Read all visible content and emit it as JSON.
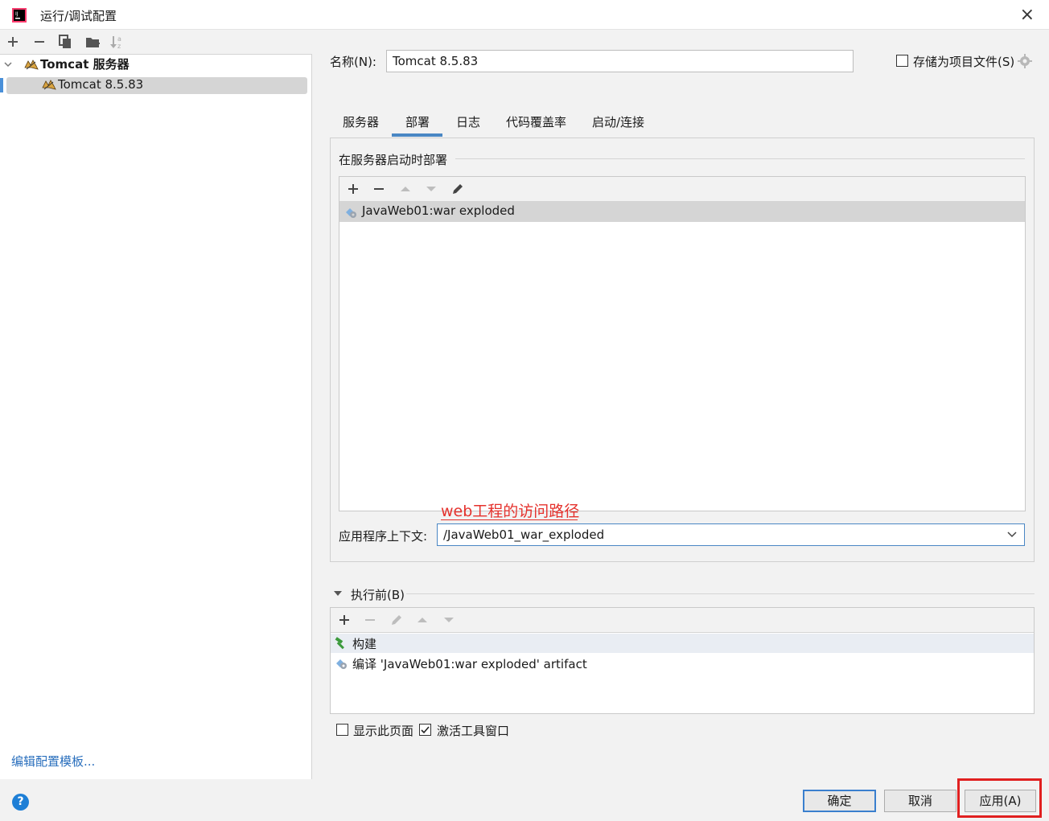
{
  "window": {
    "title": "运行/调试配置",
    "close_glyph": "×"
  },
  "left_toolbar": {
    "add_icon": "plus-icon",
    "remove_icon": "minus-icon",
    "copy_icon": "copy-icon",
    "folder_icon": "new-folder-icon",
    "sort_icon": "sort-icon"
  },
  "tree": {
    "group_label": "Tomcat 服务器",
    "group_icon": "tomcat-icon",
    "item_label": "Tomcat 8.5.83",
    "item_icon": "tomcat-icon"
  },
  "edit_templates_link": "编辑配置模板...",
  "help_glyph": "?",
  "form": {
    "name_label": "名称(N):",
    "name_value": "Tomcat 8.5.83",
    "store_as_project_label": "存储为项目文件(S)",
    "store_as_project_checked": false
  },
  "tabs": [
    {
      "label": "服务器",
      "active": false
    },
    {
      "label": "部署",
      "active": true
    },
    {
      "label": "日志",
      "active": false
    },
    {
      "label": "代码覆盖率",
      "active": false
    },
    {
      "label": "启动/连接",
      "active": false
    }
  ],
  "deploy": {
    "group_title": "在服务器启动时部署",
    "items": [
      {
        "label": "JavaWeb01:war exploded",
        "icon": "artifact-icon",
        "selected": true
      }
    ],
    "annotation": "web工程的访问路径",
    "context_label": "应用程序上下文:",
    "context_value": "/JavaWeb01_war_exploded"
  },
  "before_launch": {
    "title": "执行前(B)",
    "items": [
      {
        "label": "构建",
        "icon": "hammer-icon"
      },
      {
        "label": "编译 'JavaWeb01:war exploded' artifact",
        "icon": "artifact-icon"
      }
    ]
  },
  "options": {
    "show_page_label": "显示此页面",
    "show_page_checked": false,
    "activate_window_label": "激活工具窗口",
    "activate_window_checked": true
  },
  "buttons": {
    "ok": "确定",
    "cancel": "取消",
    "apply": "应用(A)"
  },
  "colors": {
    "accent": "#4a87c4",
    "annotation_red": "#e5322d",
    "link": "#2a6fbd"
  }
}
